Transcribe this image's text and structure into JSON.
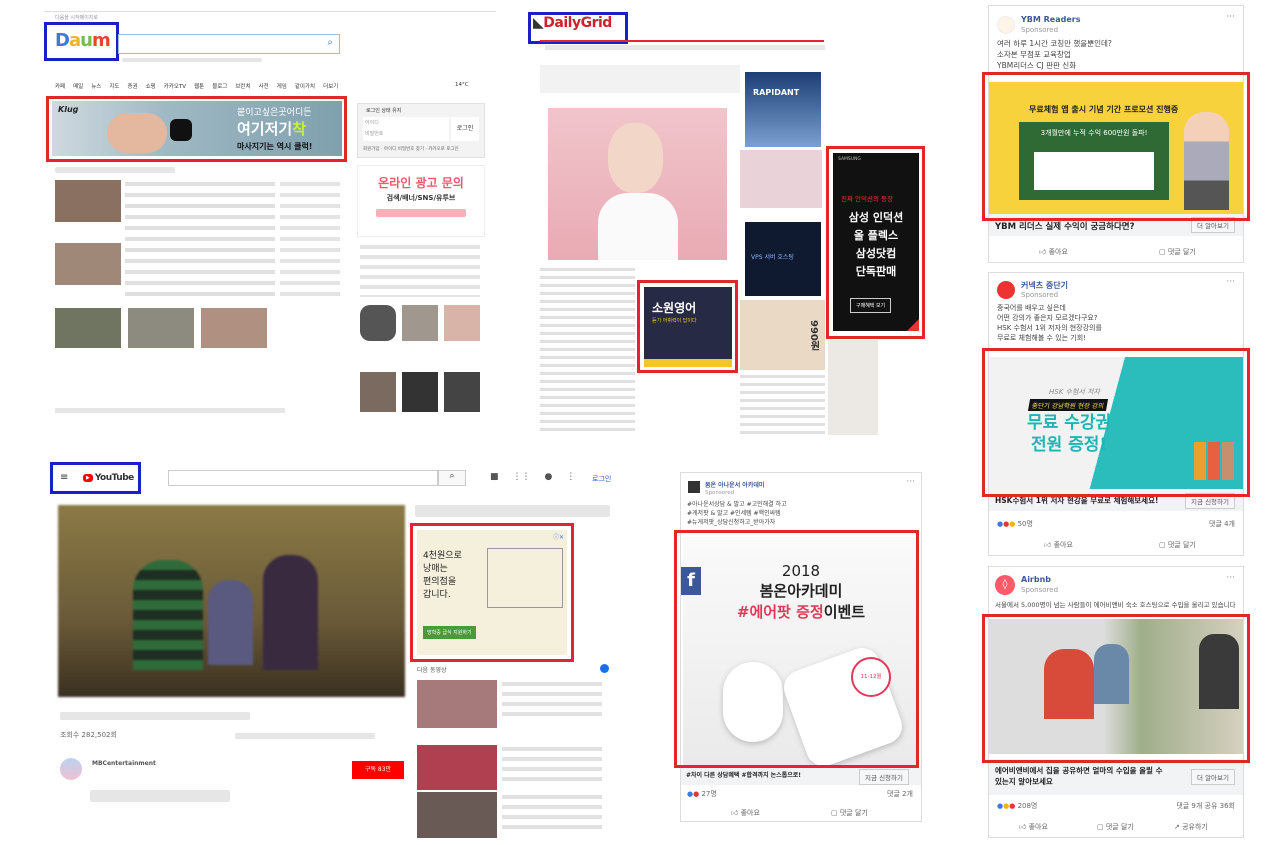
{
  "daum": {
    "logo": "Daum",
    "top_link": "다음을 시작페이지로",
    "nav": [
      "카페",
      "메일",
      "뉴스",
      "지도",
      "증권",
      "쇼핑",
      "카카오TV",
      "웹툰",
      "블로그",
      "브런치",
      "사전",
      "게임",
      "같이가치",
      "더보기"
    ],
    "weather": "14°C",
    "banner": {
      "brand": "Klug",
      "line1": "붙이고싶은곳어디든",
      "line2_a": "여기저기",
      "line2_b": "착",
      "line3": "마사지기는 역시 클럭!"
    },
    "login": {
      "keep": "로그인 상태 유지",
      "id": "아이디",
      "pw": "비밀번호",
      "button": "로그인",
      "links": "회원가입 · 아이디 비밀번호 찾기 · 카카오로 로그인"
    },
    "side_ad": {
      "line1": "온라인 광고 문의",
      "line2": "검색/배너/SNS/유투브"
    }
  },
  "dailygrid": {
    "logo": "DailyGrid",
    "side_ad1": "RAPIDANT",
    "side_ad2": "VPS 서버 호스팅",
    "price_ad": "990원",
    "small_ad": {
      "title": "소원영어",
      "sub": "듣기 어휘력이 답이다"
    },
    "samsung_ad": {
      "brand": "SAMSUNG",
      "tag": "진짜 인덕션의 등장",
      "lines": [
        "삼성 인덕션",
        "올 플렉스",
        "삼성닷컴",
        "단독판매"
      ],
      "button": "구매혜택 보기"
    }
  },
  "youtube": {
    "logo": "YouTube",
    "login": "로그인",
    "views": "조회수 282,502회",
    "channel": "MBCentertainment",
    "subscribe": "구독 83만",
    "next_label": "다음 동영상",
    "ad": {
      "lines": [
        "4천원으로",
        "낭매는",
        "편의점을",
        "갑니다."
      ],
      "button": "방학중 급식 지원하기"
    }
  },
  "fb_bomun": {
    "name": "봄온 아나운서 아카데미",
    "sponsored": "Sponsored",
    "text": [
      "#아나운서상담 & 발고 #고민해결 하고",
      "#게저팟 & 발고 #인세템 #핵인싸템",
      "#뉴게저팟_상담신청하고_받아가자"
    ],
    "ad": {
      "year": "2018",
      "title": "봄온아카데미",
      "event_a": "#에어팟 증정",
      "event_b": "이벤트",
      "badge": "11-12월"
    },
    "headline": "#차이 다른 상담혜택 #합격까지 논스톱으로!",
    "cta": "지금 신청하기",
    "reactions": "27명",
    "comments": "댓글 2개",
    "like": "좋아요",
    "comment": "댓글 달기"
  },
  "fb_ybm": {
    "name": "YBM Readers",
    "sponsored": "Sponsored",
    "text": [
      "여러 하루 1시간 코칭만 했을뿐인데?",
      "소자본 무점포 교육창업",
      "YBM리더스 CJ 판판 신화"
    ],
    "ad": {
      "title": "무료체험 앱 출시 기념 기간 프로모션 진행중",
      "board": "3개월만에 누적 수익 600만원 돌파!"
    },
    "headline": "YBM 리더스 실제 수익이 궁금하다면?",
    "cta": "더 알아보기",
    "like": "좋아요",
    "comment": "댓글 달기"
  },
  "fb_hsk": {
    "name": "커넥츠 중단기",
    "sponsored": "Sponsored",
    "text": [
      "중국어를 배우고 싶은데",
      "어떤 강의가 좋은지 모르겠다구요?",
      "HSK 수험서 1위 저자의 현장강의를",
      "무료로 체험해볼 수 있는 기회!"
    ],
    "ad": {
      "sub": "HSK 수험서 저자",
      "tag": "중단기 강남학원 현장 강의",
      "line1": "무료 수강권",
      "line2": "전원 증정!"
    },
    "headline": "HSK수험서 1위 저자 현강을 무료로 체험해보세요!",
    "cta": "지금 신청하기",
    "reactions": "50명",
    "comments": "댓글 4개",
    "like": "좋아요",
    "comment": "댓글 달기"
  },
  "fb_airbnb": {
    "name": "Airbnb",
    "sponsored": "Sponsored",
    "text": [
      "서울에서 5,000명이 넘는 사람들이 에어비앤비 숙소 호스팅으로 수입을 올리고 있습니다"
    ],
    "headline": "에어비앤비에서 집을 공유하면 얼마의 수입을 올릴 수 있는지 알아보세요",
    "cta": "더 알아보기",
    "reactions": "208명",
    "comments": "댓글 9개  공유 36회",
    "like": "좋아요",
    "comment": "댓글 달기",
    "share": "공유하기"
  },
  "colors": {
    "ad_box": "#e3262b",
    "logo_box": "#1a1fc8"
  }
}
